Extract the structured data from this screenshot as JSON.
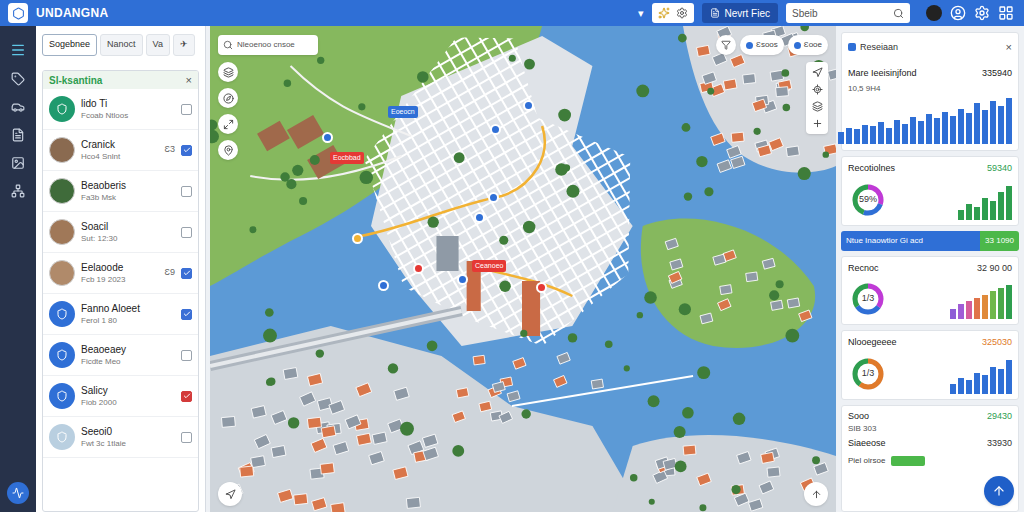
{
  "app": {
    "title": "UNDANGNA"
  },
  "top_bar": {
    "dropdown": "▾",
    "button": "Nevrt Fiec",
    "search": {
      "placeholder": "Sbeib"
    }
  },
  "left_panel": {
    "tabs": [
      {
        "label": "Sogebnee",
        "selected": true
      },
      {
        "label": "Nanoct",
        "selected": false
      },
      {
        "label": "Va",
        "selected": false
      },
      {
        "label": "✈",
        "selected": false
      }
    ],
    "list_title": "Sl-ksantina",
    "close": "×",
    "items": [
      {
        "title": "lido Ti",
        "subtitle": "Fcoab Ntloos",
        "kind": "icon",
        "color": "#1f9a6e",
        "badge": "",
        "checked": false,
        "check_color": "#3b6fd6"
      },
      {
        "title": "Cranick",
        "subtitle": "Hco4 Snlnt",
        "kind": "photo",
        "color": "#8a6a50",
        "badge": "Ɛ3",
        "checked": true,
        "check_color": "#3b6fd6"
      },
      {
        "title": "Beaoberis",
        "subtitle": "Fa3b Msk",
        "kind": "photo",
        "color": "#3f6b3a",
        "badge": "",
        "checked": false,
        "check_color": "#3b6fd6"
      },
      {
        "title": "Soacil",
        "subtitle": "Sut: 12:30",
        "kind": "photo",
        "color": "#a07858",
        "badge": "",
        "checked": false,
        "check_color": "#3b6fd6"
      },
      {
        "title": "Eelaoode",
        "subtitle": "Fcb 19 2023",
        "kind": "photo",
        "color": "#b08a6a",
        "badge": "Ɛ9",
        "checked": true,
        "check_color": "#3b6fd6"
      },
      {
        "title": "Fanno Aloeet",
        "subtitle": "Ferol 1 80",
        "kind": "icon",
        "color": "#2f6fd6",
        "badge": "",
        "checked": true,
        "check_color": "#3b6fd6"
      },
      {
        "title": "Beaoeaey",
        "subtitle": "Ficdte Meo",
        "kind": "icon",
        "color": "#2f6fd6",
        "badge": "",
        "checked": false,
        "check_color": "#3b6fd6"
      },
      {
        "title": "Salicy",
        "subtitle": "Fiob 2000",
        "kind": "icon",
        "color": "#2f6fd6",
        "badge": "",
        "checked": true,
        "check_color": "#d33b3b"
      },
      {
        "title": "Seeoi0",
        "subtitle": "Fwt 3c 1tlaie",
        "kind": "icon",
        "color": "#b9cfe0",
        "badge": "",
        "checked": false,
        "check_color": "#3b6fd6"
      }
    ]
  },
  "map": {
    "search": {
      "placeholder": "Nleoenoo cnsoe"
    },
    "chips": [
      "Ɛsoos",
      "Ɛooe"
    ],
    "pins": [
      {
        "kind": "label",
        "label": "Eocbbad",
        "color": "#e53935"
      },
      {
        "kind": "label",
        "label": "Ceanoeo",
        "color": "#e53935"
      },
      {
        "kind": "label",
        "label": "Eoeocn",
        "color": "#2f6fd6"
      },
      {
        "kind": "marker",
        "label": "",
        "color": "#2f6fd6"
      },
      {
        "kind": "marker",
        "label": "",
        "color": "#2f6fd6"
      },
      {
        "kind": "marker",
        "label": "",
        "color": "#2f6fd6"
      },
      {
        "kind": "marker",
        "label": "",
        "color": "#2f6fd6"
      },
      {
        "kind": "marker",
        "label": "",
        "color": "#2f6fd6"
      },
      {
        "kind": "marker",
        "label": "",
        "color": "#2f6fd6"
      },
      {
        "kind": "marker",
        "label": "",
        "color": "#2f6fd6"
      },
      {
        "kind": "marker",
        "label": "",
        "color": "#e53935"
      },
      {
        "kind": "marker",
        "label": "",
        "color": "#e53935"
      },
      {
        "kind": "marker",
        "label": "",
        "color": "#f2b233"
      }
    ]
  },
  "right_panel": {
    "summary": {
      "title": "Reseiaan",
      "close": "×",
      "label": "Mare Ieeisinjfond",
      "value": "335940",
      "sub": "10,5 9H4",
      "bars": [
        8,
        10,
        9,
        12,
        11,
        14,
        13,
        16,
        12,
        18,
        15,
        20,
        17,
        22,
        19,
        24,
        21,
        26,
        23,
        30,
        25,
        32,
        28,
        34
      ],
      "bar_color": "#2f6fd6"
    },
    "cards": [
      {
        "title": "Recotiolnes",
        "value": "59340",
        "value_color": "#2e9e4f",
        "donut_text": "59%",
        "segments": [
          {
            "level": 0.3,
            "color": "#c03ad6"
          },
          {
            "level": 0.25,
            "color": "#2f6fd6"
          },
          {
            "level": 0.45,
            "color": "#2e9e4f"
          }
        ],
        "bars": [
          6,
          10,
          8,
          14,
          12,
          18,
          22
        ],
        "bar_colors": [
          "#2e9e4f",
          "#2e9e4f",
          "#2e9e4f",
          "#2e9e4f",
          "#2e9e4f",
          "#2e9e4f",
          "#2e9e4f"
        ]
      },
      {
        "title": "Recnoc",
        "value": "32 90 00",
        "value_color": "#333333",
        "donut_text": "1/3",
        "segments": [
          {
            "level": 0.35,
            "color": "#c03ad6"
          },
          {
            "level": 0.3,
            "color": "#2f6fd6"
          },
          {
            "level": 0.35,
            "color": "#2e9e4f"
          }
        ],
        "bars": [
          6,
          9,
          11,
          13,
          15,
          17,
          19,
          21
        ],
        "bar_colors": [
          "#8e5cd6",
          "#a05cd6",
          "#d65c9a",
          "#e0734a",
          "#e08a3a",
          "#6fb84a",
          "#4aa84a",
          "#2e9e4f"
        ]
      },
      {
        "title": "Nlooegeeee",
        "value": "325030",
        "value_color": "#e07a2a",
        "donut_text": "1/3",
        "segments": [
          {
            "level": 0.6,
            "color": "#e07a2a"
          },
          {
            "level": 0.4,
            "color": "#2e9e4f"
          }
        ],
        "bars": [
          5,
          8,
          7,
          11,
          10,
          14,
          13,
          18
        ],
        "bar_colors": [
          "#2f6fd6",
          "#2f6fd6",
          "#2f6fd6",
          "#2f6fd6",
          "#2f6fd6",
          "#2f6fd6",
          "#2f6fd6",
          "#2f6fd6"
        ]
      }
    ],
    "banner": {
      "left": "Ntue Inaowtior Gi acd",
      "right": "33 1090"
    },
    "rows": [
      {
        "label": "Sooo",
        "value": "29430",
        "sub": "SIB 303",
        "value_color": "#2e9e4f"
      },
      {
        "label": "Siaeeose",
        "value": "33930",
        "sub": "",
        "value_color": "#333333"
      }
    ],
    "footer": {
      "label": "Piel oirsoe"
    }
  }
}
